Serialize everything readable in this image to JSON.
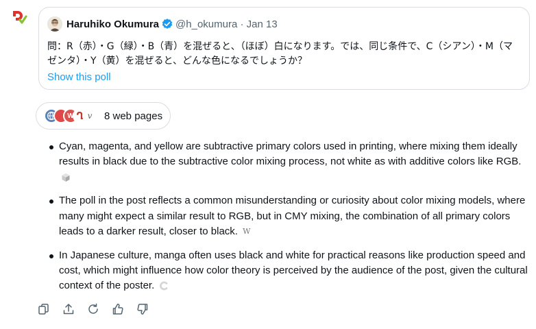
{
  "tweet": {
    "author_name": "Haruhiko Okumura",
    "handle_date": "@h_okumura · Jan 13",
    "text": "問：R（赤）・G（緑）・B（青）を混ぜると、（ほぼ）白になります。では、同じ条件で、C（シアン）・M（マゼンタ）・Y（黄）を混ぜると、どんな色になるでしょうか？",
    "show_poll_label": "Show this poll"
  },
  "sources": {
    "label": "8 web pages",
    "favicons": [
      "globe-icon",
      "red-circle-icon",
      "wikipedia-icon",
      "red-q-icon",
      "v-icon"
    ]
  },
  "answer": {
    "items": [
      {
        "text": "Cyan, magenta, and yellow are subtractive primary colors used in printing, where mixing them ideally results in black due to the subtractive color mixing process, not white as with additive colors like RGB.",
        "citation": "cube-icon"
      },
      {
        "text": "The poll in the post reflects a common misunderstanding or curiosity about color mixing models, where many might expect a similar result to RGB, but in CMY mixing, the combination of all primary colors leads to a darker result, closer to black.",
        "citation_text": "W"
      },
      {
        "text": "In Japanese culture, manga often uses black and white for practical reasons like production speed and cost, which might influence how color theory is perceived by the audience of the post, given the cultural context of the poster.",
        "citation": "c-icon"
      }
    ]
  },
  "actions": [
    "copy-icon",
    "share-icon",
    "regenerate-icon",
    "thumbs-up-icon",
    "thumbs-down-icon"
  ],
  "colors": {
    "link": "#1d9bf0",
    "text": "#0f1419",
    "muted": "#536471",
    "border": "#d9dde1",
    "brand_red": "#e0312c",
    "brand_green": "#86c232"
  }
}
